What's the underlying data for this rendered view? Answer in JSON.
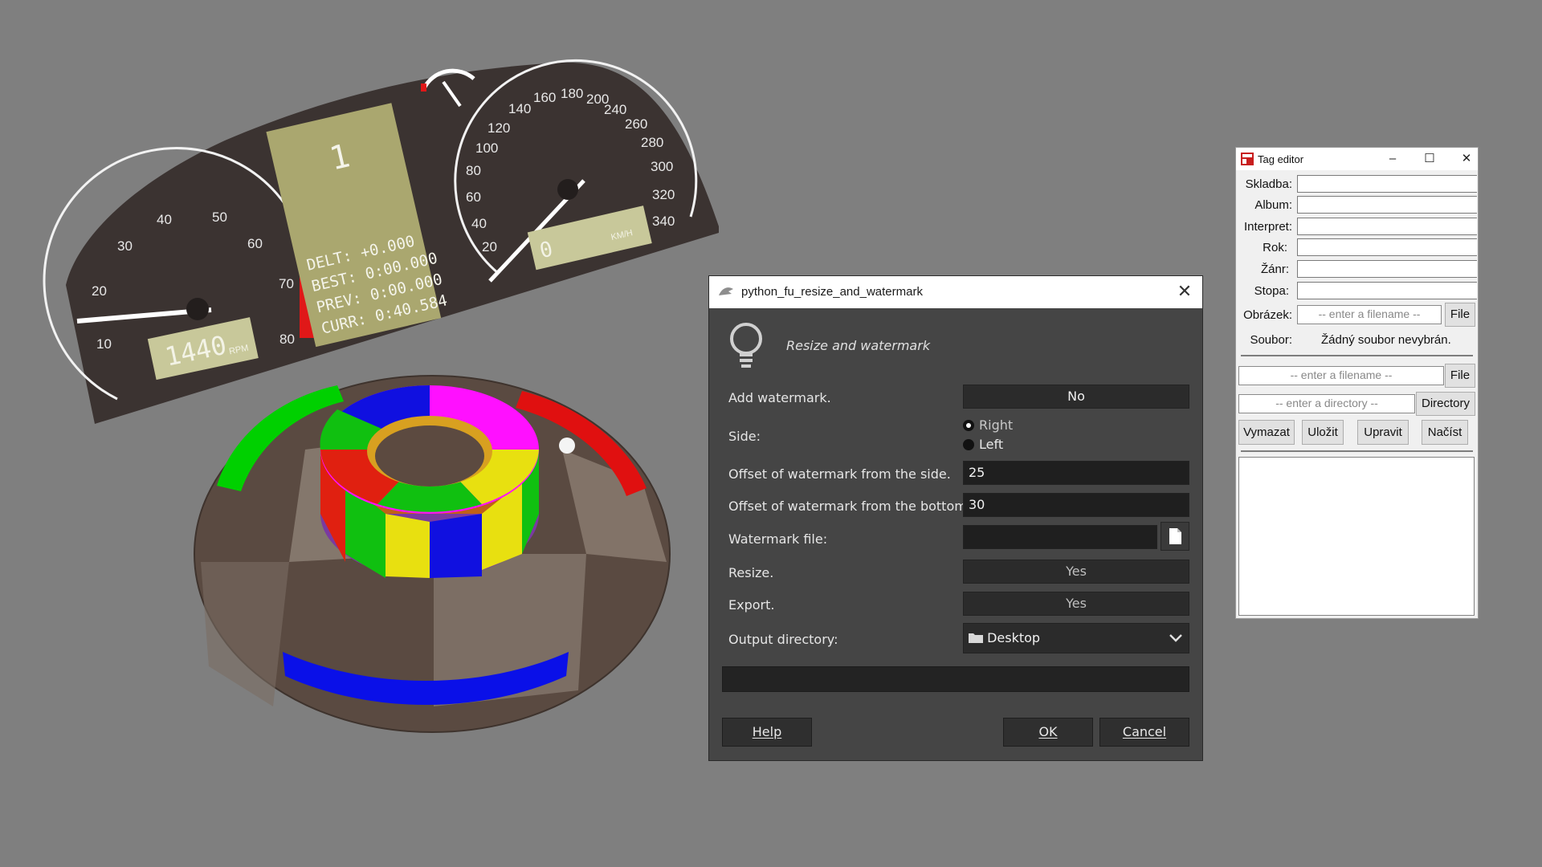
{
  "scene": {
    "dashboard": {
      "rpm_ticks": [
        "10",
        "20",
        "30",
        "40",
        "50",
        "60",
        "70",
        "80"
      ],
      "speed_ticks": [
        "20",
        "40",
        "60",
        "80",
        "100",
        "120",
        "140",
        "160",
        "180",
        "200",
        "240",
        "260",
        "280",
        "300",
        "320",
        "340"
      ],
      "rpm_readout": "1440",
      "rpm_unit": "RPM",
      "gear": "1",
      "speed_readout": "0",
      "speed_unit": "KM/H",
      "lap_lines": [
        "DELT: +0.000",
        "BEST: 0:00.000",
        "PREV: 0:00.000",
        "CURR: 0:40.584"
      ]
    }
  },
  "gimp_dialog": {
    "title": "python_fu_resize_and_watermark",
    "subtitle": "Resize and watermark",
    "add_watermark": {
      "label": "Add watermark.",
      "value": "No"
    },
    "side": {
      "label": "Side:",
      "options": [
        "Right",
        "Left"
      ],
      "selected": "Right"
    },
    "offset_side": {
      "label": "Offset of watermark from the side.",
      "value": "25"
    },
    "offset_bottom": {
      "label": "Offset of watermark from the bottom.",
      "value": "30"
    },
    "watermark_file": {
      "label": "Watermark file:",
      "value": ""
    },
    "resize": {
      "label": "Resize.",
      "value": "Yes"
    },
    "export": {
      "label": "Export.",
      "value": "Yes"
    },
    "output_directory": {
      "label": "Output directory:",
      "value": "Desktop"
    },
    "buttons": {
      "help": "Help",
      "ok": "OK",
      "cancel": "Cancel"
    }
  },
  "tag_editor": {
    "title": "Tag editor",
    "fields": [
      {
        "label": "Skladba:",
        "value": ""
      },
      {
        "label": "Album:",
        "value": ""
      },
      {
        "label": "Interpret:",
        "value": ""
      },
      {
        "label": "Rok:",
        "value": ""
      },
      {
        "label": "Žánr:",
        "value": ""
      },
      {
        "label": "Stopa:",
        "value": ""
      }
    ],
    "image": {
      "label": "Obrázek:",
      "placeholder": "-- enter a filename --",
      "button": "File"
    },
    "file": {
      "label": "Soubor:",
      "value": "Žádný soubor nevybrán."
    },
    "file2": {
      "placeholder": "-- enter a filename --",
      "button": "File"
    },
    "directory": {
      "placeholder": "-- enter a directory --",
      "button": "Directory"
    },
    "actions": [
      "Vymazat",
      "Uložit",
      "Upravit",
      "Načíst"
    ]
  }
}
